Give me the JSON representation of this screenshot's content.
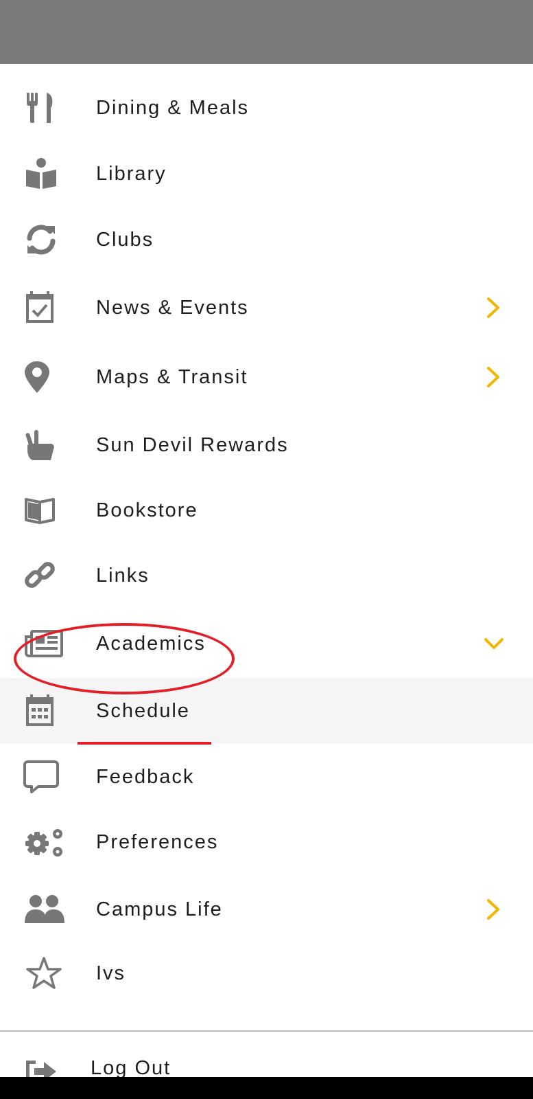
{
  "colors": {
    "top_bar": "#7a7a7a",
    "icon": "#777777",
    "chevron_accent": "#f2b705",
    "selected_bg": "#f5f5f5",
    "annotation_red": "#e21f26"
  },
  "menu": {
    "items": [
      {
        "label": "Dining & Meals",
        "icon": "fork-knife-icon"
      },
      {
        "label": "Library",
        "icon": "reading-person-icon"
      },
      {
        "label": "Clubs",
        "icon": "sync-icon"
      },
      {
        "label": "News & Events",
        "icon": "calendar-check-icon",
        "chevron": "chevron-right-icon"
      },
      {
        "label": "Maps & Transit",
        "icon": "map-pin-icon",
        "chevron": "chevron-right-icon"
      },
      {
        "label": "Sun Devil Rewards",
        "icon": "pitchfork-hand-icon"
      },
      {
        "label": "Bookstore",
        "icon": "open-book-icon"
      },
      {
        "label": "Links",
        "icon": "link-icon"
      },
      {
        "label": "Academics",
        "icon": "newspaper-icon",
        "chevron": "chevron-down-icon"
      },
      {
        "label": "Schedule",
        "icon": "calendar-grid-icon",
        "selected": true
      },
      {
        "label": "Feedback",
        "icon": "speech-bubble-icon"
      },
      {
        "label": "Preferences",
        "icon": "gears-icon"
      },
      {
        "label": "Campus Life",
        "icon": "users-icon",
        "chevron": "chevron-right-icon"
      },
      {
        "label": "Ivs",
        "icon": "star-icon"
      }
    ],
    "logout_label": "Log Out"
  }
}
